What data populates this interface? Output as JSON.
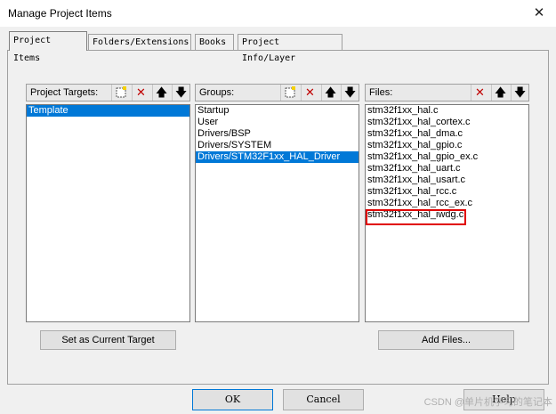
{
  "window": {
    "title": "Manage Project Items",
    "close_glyph": "✕"
  },
  "tabs": [
    {
      "label": "Project Items"
    },
    {
      "label": "Folders/Extensions"
    },
    {
      "label": "Books"
    },
    {
      "label": "Project Info/Layer"
    }
  ],
  "targets": {
    "label": "Project Targets:",
    "items": [
      "Template"
    ],
    "selected_index": 0
  },
  "groups": {
    "label": "Groups:",
    "items": [
      "Startup",
      "User",
      "Drivers/BSP",
      "Drivers/SYSTEM",
      "Drivers/STM32F1xx_HAL_Driver"
    ],
    "selected_index": 4
  },
  "files": {
    "label": "Files:",
    "items": [
      "stm32f1xx_hal.c",
      "stm32f1xx_hal_cortex.c",
      "stm32f1xx_hal_dma.c",
      "stm32f1xx_hal_gpio.c",
      "stm32f1xx_hal_gpio_ex.c",
      "stm32f1xx_hal_uart.c",
      "stm32f1xx_hal_usart.c",
      "stm32f1xx_hal_rcc.c",
      "stm32f1xx_hal_rcc_ex.c",
      "stm32f1xx_hal_iwdg.c"
    ],
    "highlighted_index": 9
  },
  "icons": {
    "new": "new-item-icon",
    "delete": "delete-icon",
    "up": "move-up-icon",
    "down": "move-down-icon"
  },
  "buttons": {
    "set_target": "Set as Current Target",
    "add_files": "Add Files...",
    "ok": "OK",
    "cancel": "Cancel",
    "help": "Help"
  },
  "watermark": "CSDN @单片机学习的笔记本",
  "colors": {
    "selection": "#0078d7",
    "highlight_box": "#e00000",
    "delete_icon": "#c00000"
  }
}
